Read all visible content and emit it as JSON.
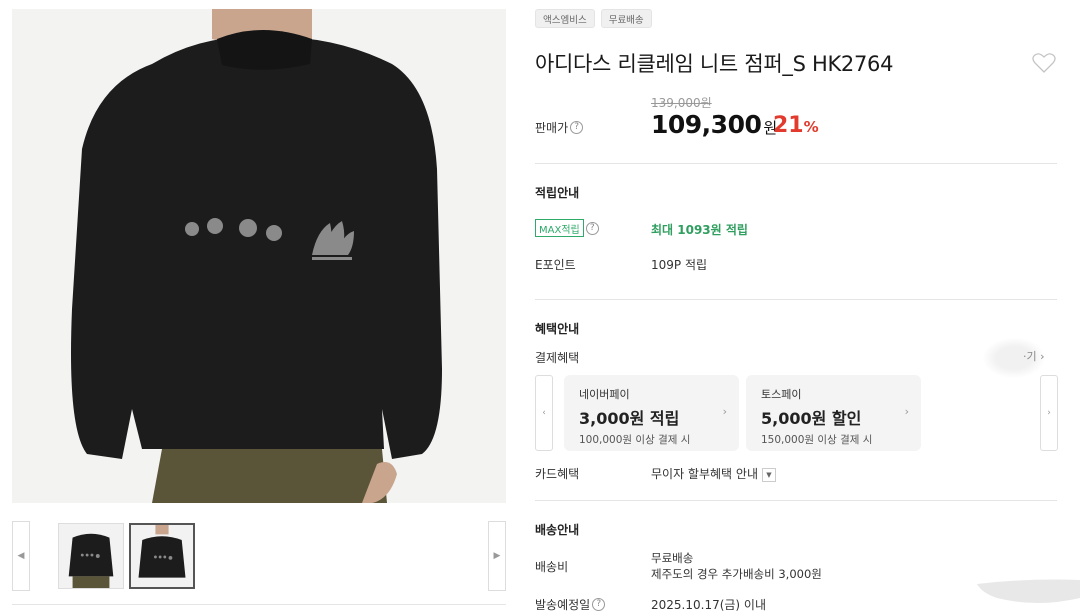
{
  "product": {
    "tags": [
      "액스엠비스",
      "무료배송"
    ],
    "title": "아디다스 리클레임 니트 점퍼_S HK2764",
    "favorite_icon": "heart-outline-icon"
  },
  "price": {
    "label": "판매가",
    "original": "139,000원",
    "sale": "109,300",
    "sale_unit": "원",
    "discount": "21",
    "discount_unit": "%"
  },
  "points": {
    "section_title": "적립안내",
    "max_badge": "MAX적립",
    "max_value": "최대 1093원 적립",
    "epoint_label": "E포인트",
    "epoint_value": "109P 적립"
  },
  "benefits": {
    "section_title": "혜택안내",
    "payment_label": "결제혜택",
    "more_text": "·기 ›",
    "cards": [
      {
        "name": "네이버페이",
        "benefit": "3,000원 적립",
        "condition": "100,000원 이상 결제 시"
      },
      {
        "name": "토스페이",
        "benefit": "5,000원 할인",
        "condition": "150,000원 이상 결제 시"
      }
    ],
    "card_label": "카드혜택",
    "card_value": "무이자 할부혜택 안내"
  },
  "delivery": {
    "section_title": "배송안내",
    "fee_label": "배송비",
    "fee_line1": "무료배송",
    "fee_line2": "제주도의 경우 추가배송비 3,000원",
    "date_label": "발송예정일",
    "date_value": "2025.10.17(금) 이내"
  },
  "colors": {
    "discount": "#e23b2d",
    "points_green": "#2f9e5f"
  }
}
